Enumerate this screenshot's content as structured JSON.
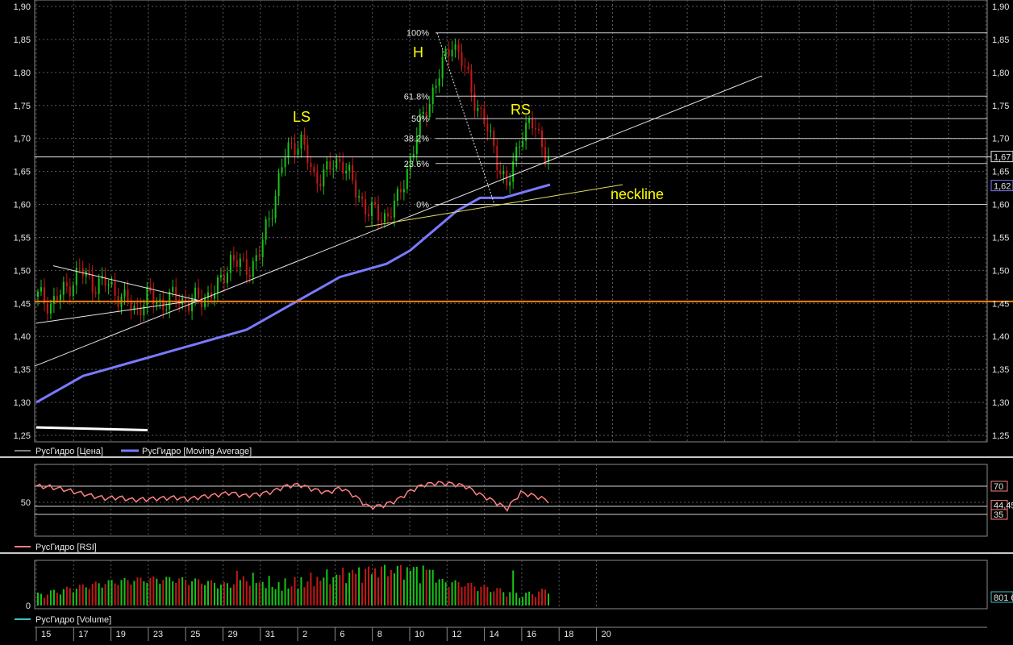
{
  "colors": {
    "background": "#000000",
    "bull": "#18c418",
    "bear": "#c41818",
    "ma": "#7a7aff",
    "rsi": "#ff8080",
    "support": "#ff8000",
    "pattern_text": "#ffff00",
    "grid": "#5a5a5a"
  },
  "chart_data": [
    {
      "type": "line",
      "panel": "price",
      "series": [
        {
          "name": "РусГидро [Цена]",
          "values": [
            1.46,
            1.45,
            1.47,
            1.5,
            1.48,
            1.48,
            1.46,
            1.44,
            1.46,
            1.45,
            1.46,
            1.45,
            1.46,
            1.47,
            1.52,
            1.5,
            1.52,
            1.6,
            1.68,
            1.7,
            1.64,
            1.65,
            1.67,
            1.62,
            1.59,
            1.58,
            1.6,
            1.67,
            1.74,
            1.79,
            1.85,
            1.8,
            1.74,
            1.69,
            1.62,
            1.71,
            1.72,
            1.67
          ]
        },
        {
          "name": "РусГидро [Moving Average]",
          "values": [
            1.3,
            1.32,
            1.34,
            1.35,
            1.36,
            1.37,
            1.38,
            1.39,
            1.4,
            1.41,
            1.43,
            1.45,
            1.47,
            1.49,
            1.5,
            1.51,
            1.53,
            1.56,
            1.59,
            1.61,
            1.61,
            1.62,
            1.63
          ]
        }
      ],
      "x_tick_labels": [
        "15",
        "17",
        "19",
        "23",
        "25",
        "29",
        "31",
        "2",
        "6",
        "8",
        "10",
        "12",
        "14",
        "16",
        "18",
        "20"
      ],
      "y_tick_labels": [
        "1,25",
        "1,30",
        "1,35",
        "1,40",
        "1,45",
        "1,50",
        "1,55",
        "1,60",
        "1,65",
        "1,70",
        "1,75",
        "1,80",
        "1,85",
        "1,90"
      ],
      "ylim": [
        1.24,
        1.91
      ],
      "grid": true,
      "legend": "bottom-left",
      "price_tags": [
        "1,67",
        "1,62"
      ],
      "annotations": {
        "left_shoulder": "LS",
        "head": "H",
        "right_shoulder": "RS",
        "neckline": "neckline",
        "fib_levels": [
          "100%",
          "61.8%",
          "50%",
          "38.2%",
          "23.6%",
          "0%"
        ]
      }
    },
    {
      "type": "line",
      "panel": "rsi",
      "series": [
        {
          "name": "РусГидро [RSI]",
          "values": [
            70,
            69,
            66,
            62,
            58,
            55,
            56,
            53,
            54,
            55,
            56,
            54,
            57,
            59,
            62,
            58,
            60,
            63,
            70,
            72,
            66,
            62,
            68,
            58,
            44,
            46,
            52,
            64,
            72,
            74,
            73,
            70,
            60,
            52,
            42,
            62,
            58,
            52
          ]
        }
      ],
      "y_tick_labels": [
        "50"
      ],
      "levels": [
        70,
        35
      ],
      "tags": [
        "70",
        "44,45",
        "35"
      ]
    },
    {
      "type": "bar",
      "panel": "volume",
      "series": [
        {
          "name": "РусГидро [Volume]"
        }
      ],
      "y_tick_labels": [
        "0"
      ],
      "tags": [
        "801 6"
      ]
    }
  ]
}
